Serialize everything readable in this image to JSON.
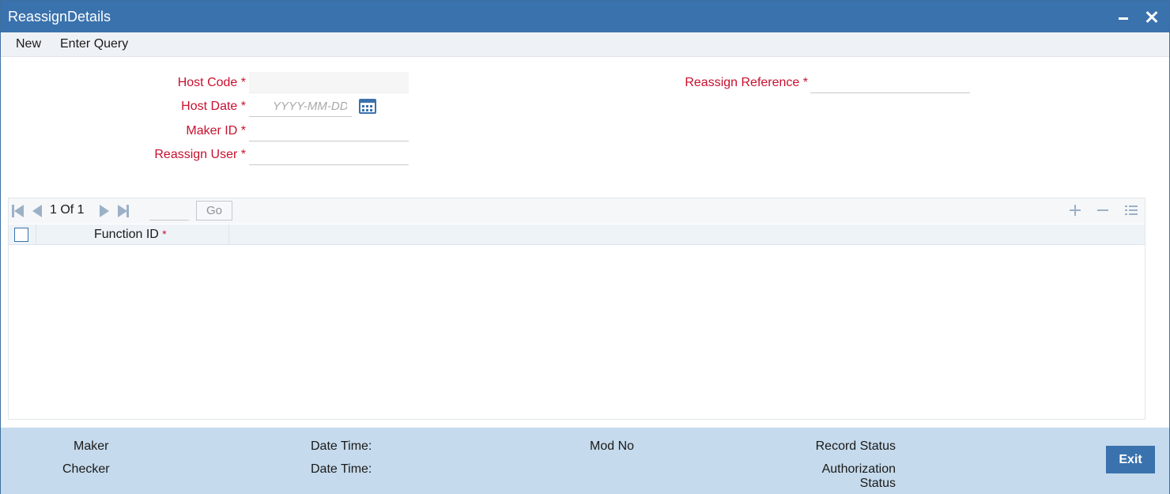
{
  "window": {
    "title": "ReassignDetails"
  },
  "menu": {
    "new_label": "New",
    "enter_query_label": "Enter Query"
  },
  "form": {
    "required_mark": "*",
    "host_code": {
      "label": "Host Code",
      "value": ""
    },
    "host_date": {
      "label": "Host Date",
      "value": "",
      "placeholder": "YYYY-MM-DD"
    },
    "maker_id": {
      "label": "Maker ID",
      "value": ""
    },
    "reassign_user": {
      "label": "Reassign User",
      "value": ""
    },
    "reassign_reference": {
      "label": "Reassign Reference",
      "value": ""
    }
  },
  "grid": {
    "pager_text": "1 Of 1",
    "go_label": "Go",
    "columns": [
      {
        "label": "Function ID",
        "required_mark": "*"
      }
    ],
    "rows": []
  },
  "footer": {
    "maker_label": "Maker",
    "checker_label": "Checker",
    "date_time_label_1": "Date Time:",
    "date_time_label_2": "Date Time:",
    "mod_no_label": "Mod No",
    "record_status_label": "Record Status",
    "authorization_label": "Authorization",
    "status_label": "Status",
    "exit_label": "Exit"
  },
  "colors": {
    "titlebar": "#3a72ad",
    "required_label": "#c8102e",
    "footer_bg": "#c5daec"
  }
}
